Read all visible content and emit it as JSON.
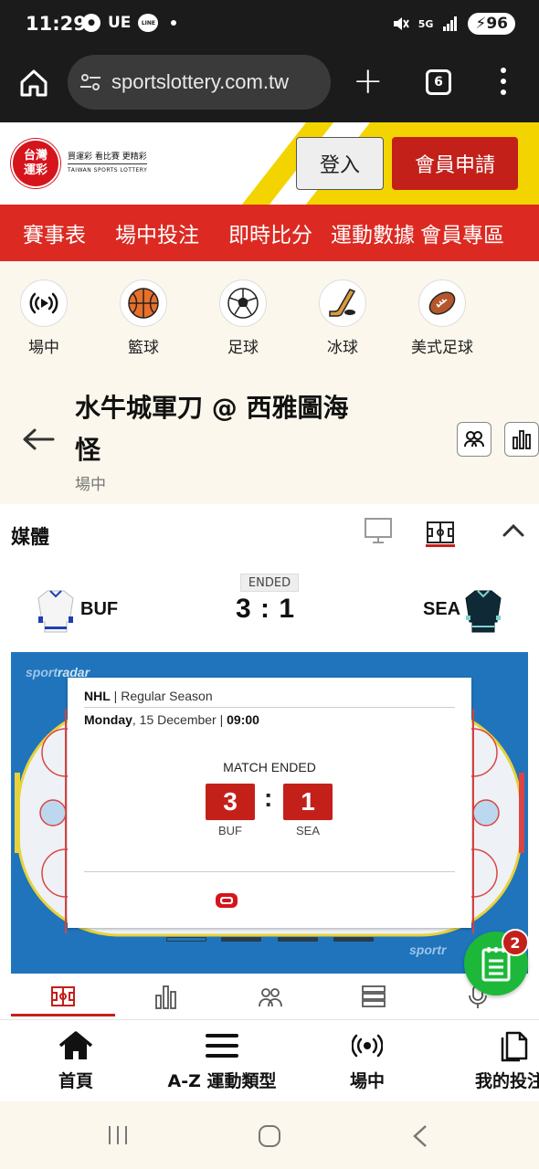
{
  "status_bar": {
    "time": "11:29",
    "carrier": "UE",
    "line_badge": "LINE",
    "network": "5G",
    "battery": "96"
  },
  "browser": {
    "url": "sportslottery.com.tw",
    "tab_count": "6"
  },
  "site_header": {
    "logo_text": "台灣運彩",
    "slogan": "買運彩 看比賽 更精彩",
    "logo_english": "TAIWAN SPORTS LOTTERY",
    "login_label": "登入",
    "register_label": "會員申請"
  },
  "main_nav": [
    "賽事表",
    "場中投注",
    "即時比分",
    "運動數據",
    "會員專區"
  ],
  "sports": [
    {
      "label": "場中",
      "icon": "live-icon"
    },
    {
      "label": "籃球",
      "icon": "basketball-icon"
    },
    {
      "label": "足球",
      "icon": "soccer-icon"
    },
    {
      "label": "冰球",
      "icon": "hockey-icon"
    },
    {
      "label": "美式足球",
      "icon": "american-football-icon"
    }
  ],
  "event": {
    "title": "水牛城軍刀 @ 西雅圖海怪",
    "subtitle": "場中"
  },
  "media": {
    "title": "媒體",
    "status": "ENDED",
    "home_abbr": "BUF",
    "away_abbr": "SEA",
    "score": "3 : 1"
  },
  "widget": {
    "brand_light": "sport",
    "brand_bold": "radar",
    "brand_bottom": "sportr",
    "league": "NHL",
    "season": "Regular Season",
    "day": "Monday",
    "date": "15 December",
    "time": "09:00",
    "match_status": "MATCH ENDED",
    "home_score": "3",
    "away_score": "1",
    "home_abbr": "BUF",
    "away_abbr": "SEA"
  },
  "bet_slip": {
    "count": "2"
  },
  "bottom_nav": [
    {
      "label": "首頁",
      "icon": "home-icon"
    },
    {
      "label": "A-Z 運動類型",
      "icon": "menu-icon"
    },
    {
      "label": "場中",
      "icon": "live-broadcast-icon"
    },
    {
      "label": "我的投注",
      "icon": "copy-icon"
    }
  ],
  "colors": {
    "brand_red": "#dc2a22",
    "button_red": "#c4201a",
    "rink_blue": "#1f74bb",
    "fab_green": "#1db83a"
  }
}
